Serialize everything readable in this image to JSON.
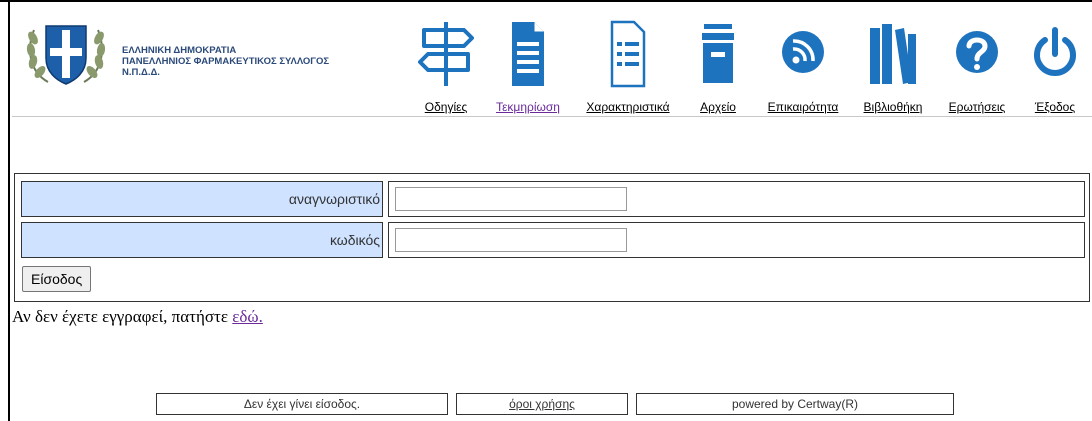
{
  "header": {
    "org_lines": [
      "ΕΛΛΗΝΙΚΗ ΔΗΜΟΚΡΑΤΙΑ",
      "ΠΑΝΕΛΛΗΝΙΟΣ ΦΑΡΜΑΚΕΥΤΙΚΟΣ ΣΥΛΛΟΓΟΣ",
      "Ν.Π.Δ.Δ."
    ],
    "nav": [
      {
        "label": "Οδηγίες",
        "icon": "signpost-icon"
      },
      {
        "label": "Τεκμηρίωση",
        "icon": "document-icon"
      },
      {
        "label": "Χαρακτηριστικά",
        "icon": "checklist-icon"
      },
      {
        "label": "Αρχείο",
        "icon": "archive-icon"
      },
      {
        "label": "Επικαιρότητα",
        "icon": "rss-icon"
      },
      {
        "label": "Βιβλιοθήκη",
        "icon": "books-icon"
      },
      {
        "label": "Ερωτήσεις",
        "icon": "question-icon"
      },
      {
        "label": "Έξοδος",
        "icon": "power-icon"
      }
    ]
  },
  "login": {
    "username_label": "αναγνωριστικό",
    "username_value": "",
    "password_label": "κωδικός",
    "password_value": "",
    "submit_label": "Είσοδος"
  },
  "register": {
    "text": "Αν δεν έχετε εγγραφεί, πατήστε ",
    "link": "εδώ."
  },
  "footer": {
    "status": "Δεν έχει γίνει είσοδος.",
    "terms": "όροι χρήσης",
    "powered": "powered by Certway(R)"
  },
  "colors": {
    "accent": "#1e73be",
    "label_bg": "#cfe2ff",
    "org_text": "#2b4a7a",
    "visited_link": "#6a2a9a"
  }
}
